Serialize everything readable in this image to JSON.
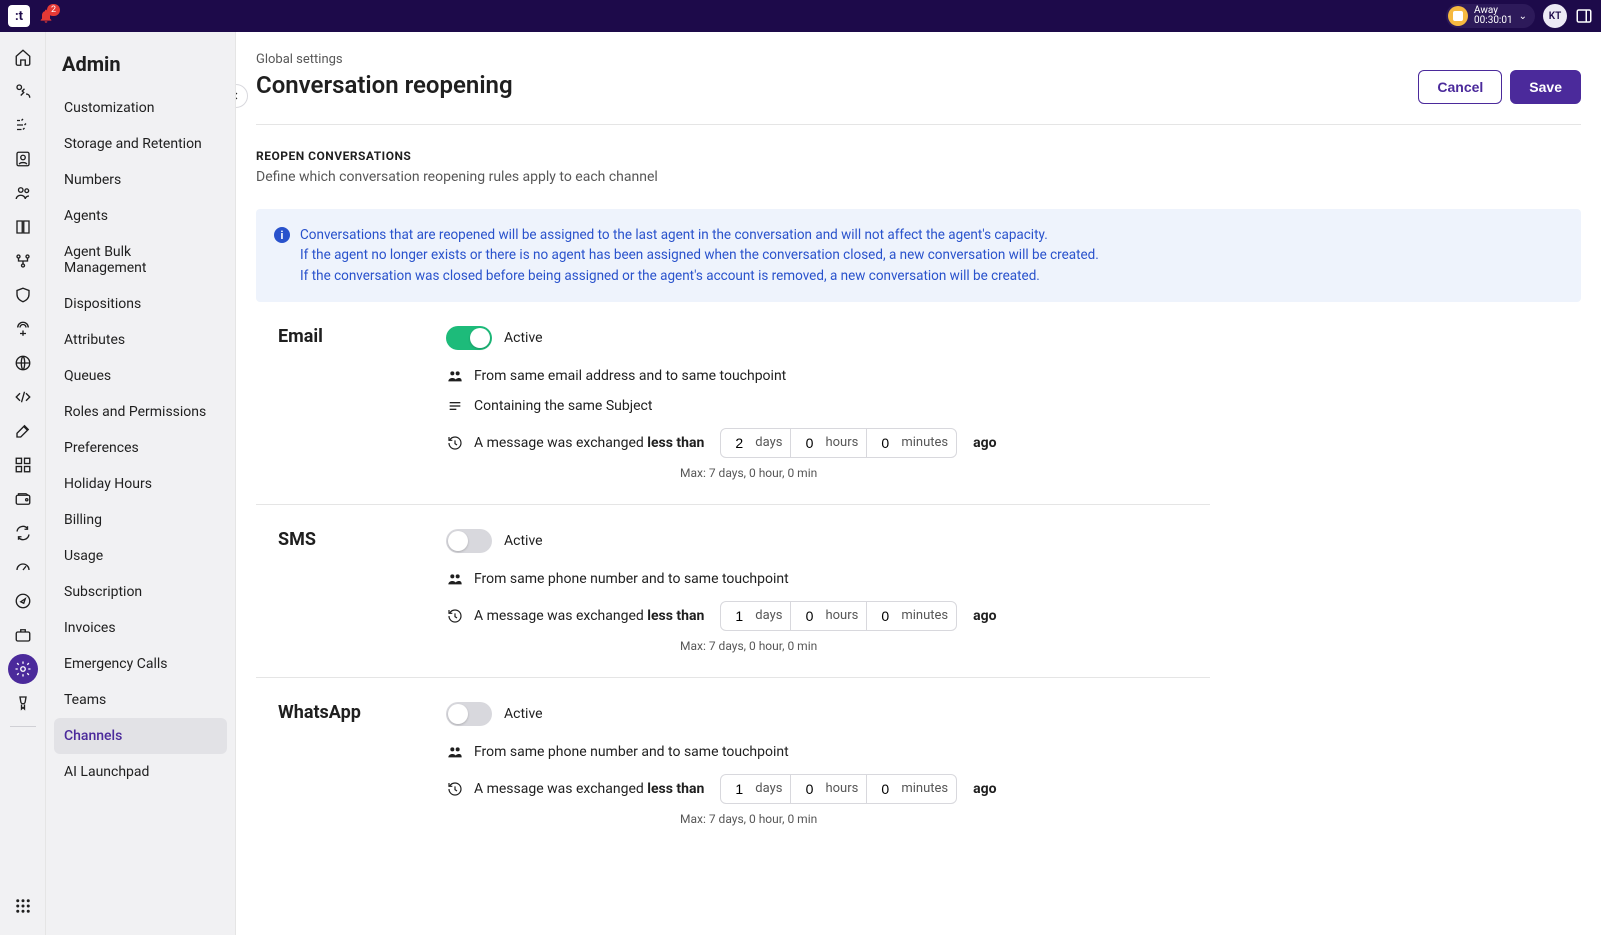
{
  "topbar": {
    "notification_count": "2",
    "status_label": "Away",
    "status_timer": "00:30:01",
    "avatar_initials": "KT"
  },
  "sidebar": {
    "title": "Admin",
    "items": [
      "Customization",
      "Storage and Retention",
      "Numbers",
      "Agents",
      "Agent Bulk Management",
      "Dispositions",
      "Attributes",
      "Queues",
      "Roles and Permissions",
      "Preferences",
      "Holiday Hours",
      "Billing",
      "Usage",
      "Subscription",
      "Invoices",
      "Emergency Calls",
      "Teams",
      "Channels",
      "AI Launchpad"
    ],
    "active_index": 17
  },
  "page": {
    "crumb": "Global settings",
    "title": "Conversation reopening",
    "cancel": "Cancel",
    "save": "Save",
    "section_label": "REOPEN CONVERSATIONS",
    "section_desc": "Define which conversation reopening rules apply to each channel",
    "banner_line1": "Conversations that are reopened will be assigned to the last agent in the conversation and will not affect the agent's capacity.",
    "banner_line2": "If the agent no longer exists or there is no agent has been assigned when the conversation closed, a new conversation will be created.",
    "banner_line3": "If the conversation was closed before being assigned or the agent's account is removed, a new conversation will be created."
  },
  "common": {
    "active": "Active",
    "msg_prefix": "A message was exchanged ",
    "msg_bold": "less than",
    "ago": "ago",
    "days": "days",
    "hours": "hours",
    "minutes": "minutes",
    "max_hint": "Max: 7 days, 0 hour, 0 min"
  },
  "channels": [
    {
      "name": "Email",
      "active": true,
      "from_rule": "From same email address and to same touchpoint",
      "subject_rule": "Containing the same Subject",
      "days": "2",
      "hours": "0",
      "minutes": "0"
    },
    {
      "name": "SMS",
      "active": false,
      "from_rule": "From same phone number and to same touchpoint",
      "days": "1",
      "hours": "0",
      "minutes": "0"
    },
    {
      "name": "WhatsApp",
      "active": false,
      "from_rule": "From same phone number and to same touchpoint",
      "days": "1",
      "hours": "0",
      "minutes": "0"
    }
  ]
}
